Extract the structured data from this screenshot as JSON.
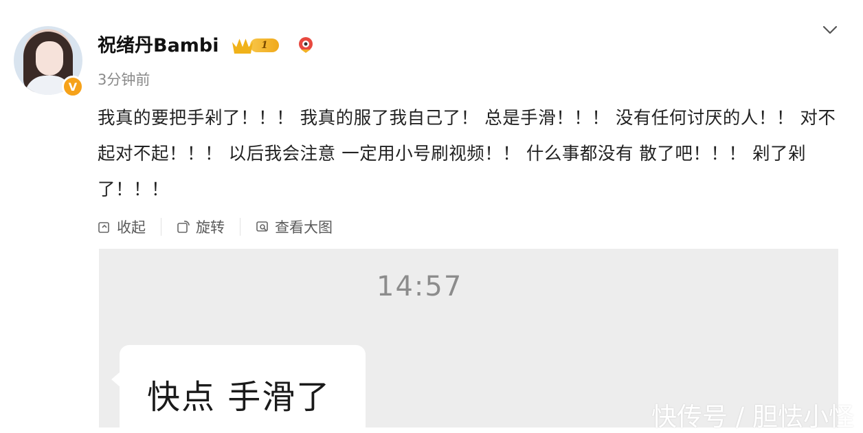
{
  "post": {
    "username": "祝绪丹Bambi",
    "vip_level": "1",
    "time": "3分钟前",
    "text": "我真的要把手剁了！！！ 我真的服了我自己了！ 总是手滑！！！ 没有任何讨厌的人！！ 对不起对不起！！！ 以后我会注意 一定用小号刷视频！！ 什么事都没有 散了吧！！！ 剁了剁了！！！"
  },
  "actions": {
    "collapse": "收起",
    "rotate": "旋转",
    "view_large": "查看大图"
  },
  "image": {
    "time": "14:57",
    "bubble_text": "快点 手滑了"
  },
  "watermark": "快传号 / 胆怯小怪",
  "colors": {
    "accent": "#f6a21a",
    "text": "#222222",
    "muted": "#8a8a8a"
  },
  "icons": {
    "verified": "verified-v-icon",
    "vip": "crown-icon",
    "fan": "fan-icon",
    "menu": "chevron-down-icon"
  }
}
